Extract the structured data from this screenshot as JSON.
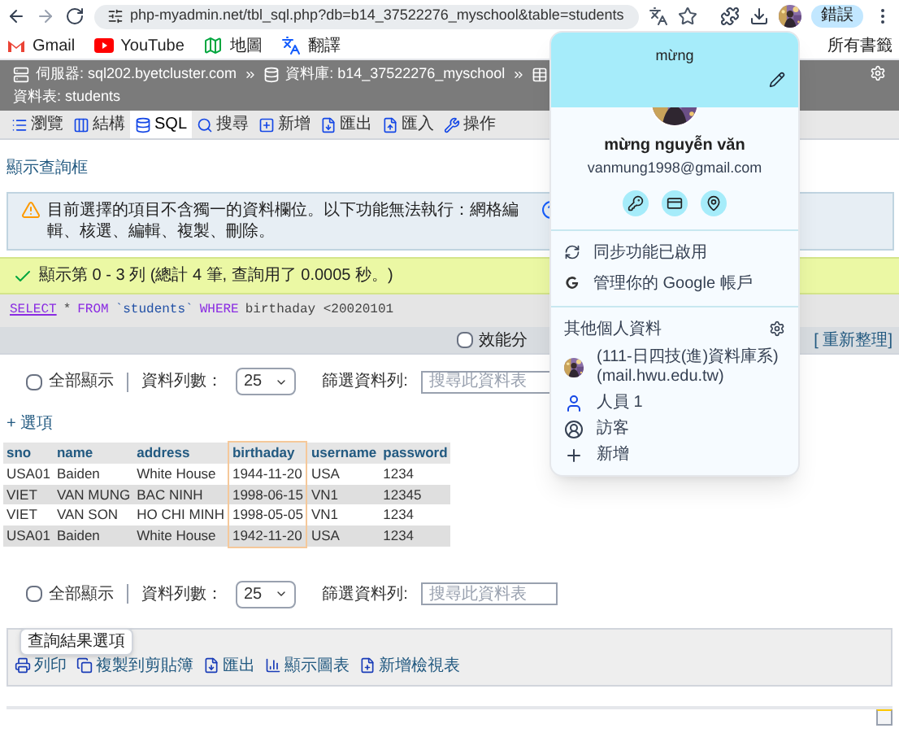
{
  "browser": {
    "url": "php-myadmin.net/tbl_sql.php?db=b14_37522276_myschool&table=students",
    "profile_button": "錯誤"
  },
  "bookmarks": [
    {
      "label": "Gmail",
      "kind": "gmail"
    },
    {
      "label": "YouTube",
      "kind": "youtube"
    },
    {
      "label": "地圖",
      "kind": "maps"
    },
    {
      "label": "翻譯",
      "kind": "translate"
    }
  ],
  "all_bookmarks": "所有書籤",
  "breadcrumb": [
    {
      "label": "伺服器: sql202.byetcluster.com",
      "kind": "server"
    },
    {
      "label": "資料庫: b14_37522276_myschool",
      "kind": "database"
    },
    {
      "label": "資料表: students",
      "kind": "table"
    }
  ],
  "tabs": [
    {
      "label": "瀏覽",
      "kind": "browse",
      "selected": false
    },
    {
      "label": "結構",
      "kind": "structure",
      "selected": false
    },
    {
      "label": "SQL",
      "kind": "sql",
      "selected": true
    },
    {
      "label": "搜尋",
      "kind": "search",
      "selected": false
    },
    {
      "label": "新增",
      "kind": "insert",
      "selected": false
    },
    {
      "label": "匯出",
      "kind": "export",
      "selected": false
    },
    {
      "label": "匯入",
      "kind": "import",
      "selected": false
    },
    {
      "label": "操作",
      "kind": "operations",
      "selected": false
    }
  ],
  "show_query_box": "顯示查詢框",
  "warning": "目前選擇的項目不含獨一的資料欄位。以下功能無法執行：網格編輯、核選、編輯、複製、刪除。",
  "success": "顯示第 0 - 3 列 (總計 4 筆, 查詢用了 0.0005 秒。)",
  "sql": [
    {
      "text": "SELECT",
      "kind": "keyword"
    },
    {
      "text": "*",
      "kind": "plain"
    },
    {
      "text": "FROM",
      "kind": "keyword"
    },
    {
      "text": "`students`",
      "kind": "identifier"
    },
    {
      "text": "WHERE",
      "kind": "keyword"
    },
    {
      "text": "birthaday <20020101",
      "kind": "plain"
    }
  ],
  "profiling": {
    "label": "效能分",
    "checked": false
  },
  "refresh": "[ 重新整理]",
  "controls": [
    {
      "show_all": "全部顯示",
      "checked": false,
      "rows_label": "資料列數：",
      "rows_value": "25",
      "filter_label": "篩選資料列:",
      "filter_placeholder": "搜尋此資料表"
    },
    {
      "show_all": "全部顯示",
      "checked": false,
      "rows_label": "資料列數：",
      "rows_value": "25",
      "filter_label": "篩選資料列:",
      "filter_placeholder": "搜尋此資料表"
    }
  ],
  "options_link": "+ 選項",
  "table": {
    "columns": [
      {
        "label": "sno",
        "highlighted": false
      },
      {
        "label": "name",
        "highlighted": false
      },
      {
        "label": "address",
        "highlighted": false
      },
      {
        "label": "birthaday",
        "highlighted": true
      },
      {
        "label": "username",
        "highlighted": false
      },
      {
        "label": "password",
        "highlighted": false
      }
    ],
    "rows": [
      [
        "USA01",
        "Baiden",
        "White House",
        "1944-11-20",
        "USA",
        "1234"
      ],
      [
        "VIET",
        "VAN MUNG",
        "BAC NINH",
        "1998-06-15",
        "VN1",
        "12345"
      ],
      [
        "VIET",
        "VAN SON",
        "HO CHI MINH",
        "1998-05-05",
        "VN1",
        "1234"
      ],
      [
        "USA01",
        "Baiden",
        "White House",
        "1942-11-20",
        "USA",
        "1234"
      ]
    ]
  },
  "result_ops": {
    "legend": "查詢結果選項",
    "items": [
      {
        "label": "列印",
        "kind": "print"
      },
      {
        "label": "複製到剪貼簿",
        "kind": "copy"
      },
      {
        "label": "匯出",
        "kind": "export"
      },
      {
        "label": "顯示圖表",
        "kind": "chart"
      },
      {
        "label": "新增檢視表",
        "kind": "view"
      }
    ]
  },
  "account": {
    "header_name": "mừng",
    "name": "mừng nguyễn văn",
    "email": "vanmung1998@gmail.com",
    "sync": "同步功能已啟用",
    "manage": "管理你的 Google 帳戶",
    "others_title": "其他個人資料",
    "profiles": [
      {
        "label": "(111-日四技(進)資料庫系) (mail.hwu.edu.tw)",
        "kind": "avatar"
      },
      {
        "label": "人員 1",
        "kind": "person"
      },
      {
        "label": "訪客",
        "kind": "guest"
      },
      {
        "label": "新增",
        "kind": "add"
      }
    ]
  }
}
